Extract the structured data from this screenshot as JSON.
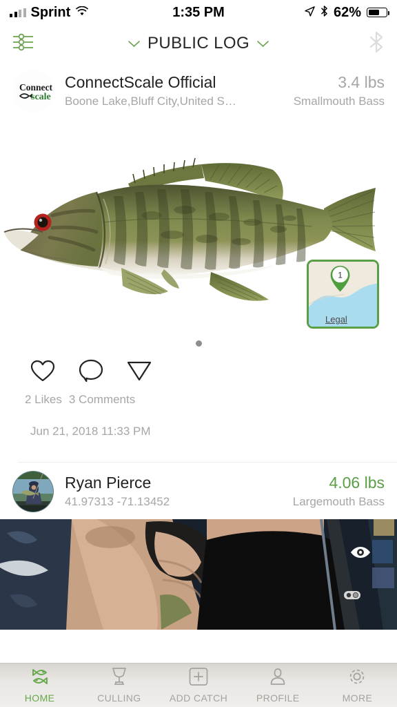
{
  "status_bar": {
    "carrier": "Sprint",
    "wifi_icon": "wifi-icon",
    "time": "1:35 PM",
    "location_icon": "location-arrow-icon",
    "bluetooth_icon": "bluetooth-icon",
    "battery_percent": "62%",
    "battery_level": 62
  },
  "nav": {
    "filter_icon": "sliders-filter-icon",
    "left_chevron": "⌄",
    "title": "PUBLIC LOG",
    "right_chevron": "⌄",
    "bluetooth_icon": "bluetooth-icon"
  },
  "colors": {
    "accent_green": "#66a84e",
    "weight_green": "#5a9e45",
    "muted_gray": "#a6a6a6",
    "text_dark": "#222222"
  },
  "posts": [
    {
      "avatar_name": "connectscale-logo-avatar",
      "logo_text_top": "Connect",
      "logo_text_bottom": "scale",
      "user": "ConnectScale Official",
      "location": "Boone Lake,Bluff City,United S…",
      "weight": "3.4 lbs",
      "species": "Smallmouth Bass",
      "weight_is_green": false,
      "map": {
        "pin_number": "1",
        "label": "Legal"
      },
      "page_dots": 1,
      "like_icon": "heart-icon",
      "comment_icon": "comment-bubble-icon",
      "share_icon": "send-share-icon",
      "likes": "2 Likes",
      "comments": "3 Comments",
      "timestamp": "Jun 21, 2018 11:33 PM"
    },
    {
      "avatar_name": "user-photo-avatar",
      "user": "Ryan Pierce",
      "location": "41.97313 -71.13452",
      "weight": "4.06 lbs",
      "species": "Largemouth Bass",
      "weight_is_green": true,
      "visibility_icon": "eye-icon",
      "attachment_icon": "clip-icon"
    }
  ],
  "tabbar": {
    "items": [
      {
        "label": "HOME",
        "icon": "two-fish-icon",
        "active": true
      },
      {
        "label": "CULLING",
        "icon": "trophy-icon",
        "active": false
      },
      {
        "label": "ADD CATCH",
        "icon": "plus-square-icon",
        "active": false
      },
      {
        "label": "PROFILE",
        "icon": "person-icon",
        "active": false
      },
      {
        "label": "MORE",
        "icon": "gear-icon",
        "active": false
      }
    ]
  }
}
